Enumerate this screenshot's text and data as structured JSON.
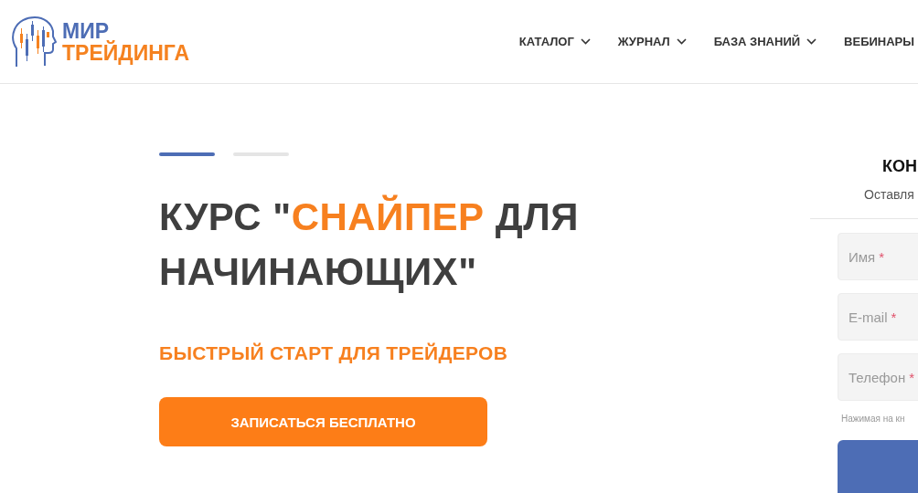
{
  "logo": {
    "line_1": "МИР",
    "line_2": "ТРЕЙДИНГА"
  },
  "nav": [
    {
      "label": "КАТАЛОГ",
      "dropdown": true
    },
    {
      "label": "ЖУРНАЛ",
      "dropdown": true
    },
    {
      "label": "БАЗА ЗНАНИЙ",
      "dropdown": true
    },
    {
      "label": "ВЕБИНАРЫ",
      "dropdown": false
    }
  ],
  "slider_dots": [
    {
      "selected": true
    },
    {
      "selected": false
    }
  ],
  "hero": {
    "title": "КУРС \"",
    "title_accent": "СНАЙПЕР",
    "title_rest": " ДЛЯ НАЧИНАЮЩИХ\"",
    "subtitle": "БЫСТРЫЙ СТАРТ ДЛЯ ТРЕЙДЕРОВ",
    "button": "ЗАПИСАТЬСЯ БЕСПЛАТНО"
  },
  "form": {
    "title": "КОН",
    "subtitle": "Оставля",
    "fields": [
      {
        "placeholder": "Имя",
        "required_mark": "*"
      },
      {
        "placeholder": "E-mail",
        "required_mark": "*"
      },
      {
        "placeholder": "Телефон",
        "required_mark": "*"
      }
    ],
    "note": "Нажимая на кн"
  }
}
